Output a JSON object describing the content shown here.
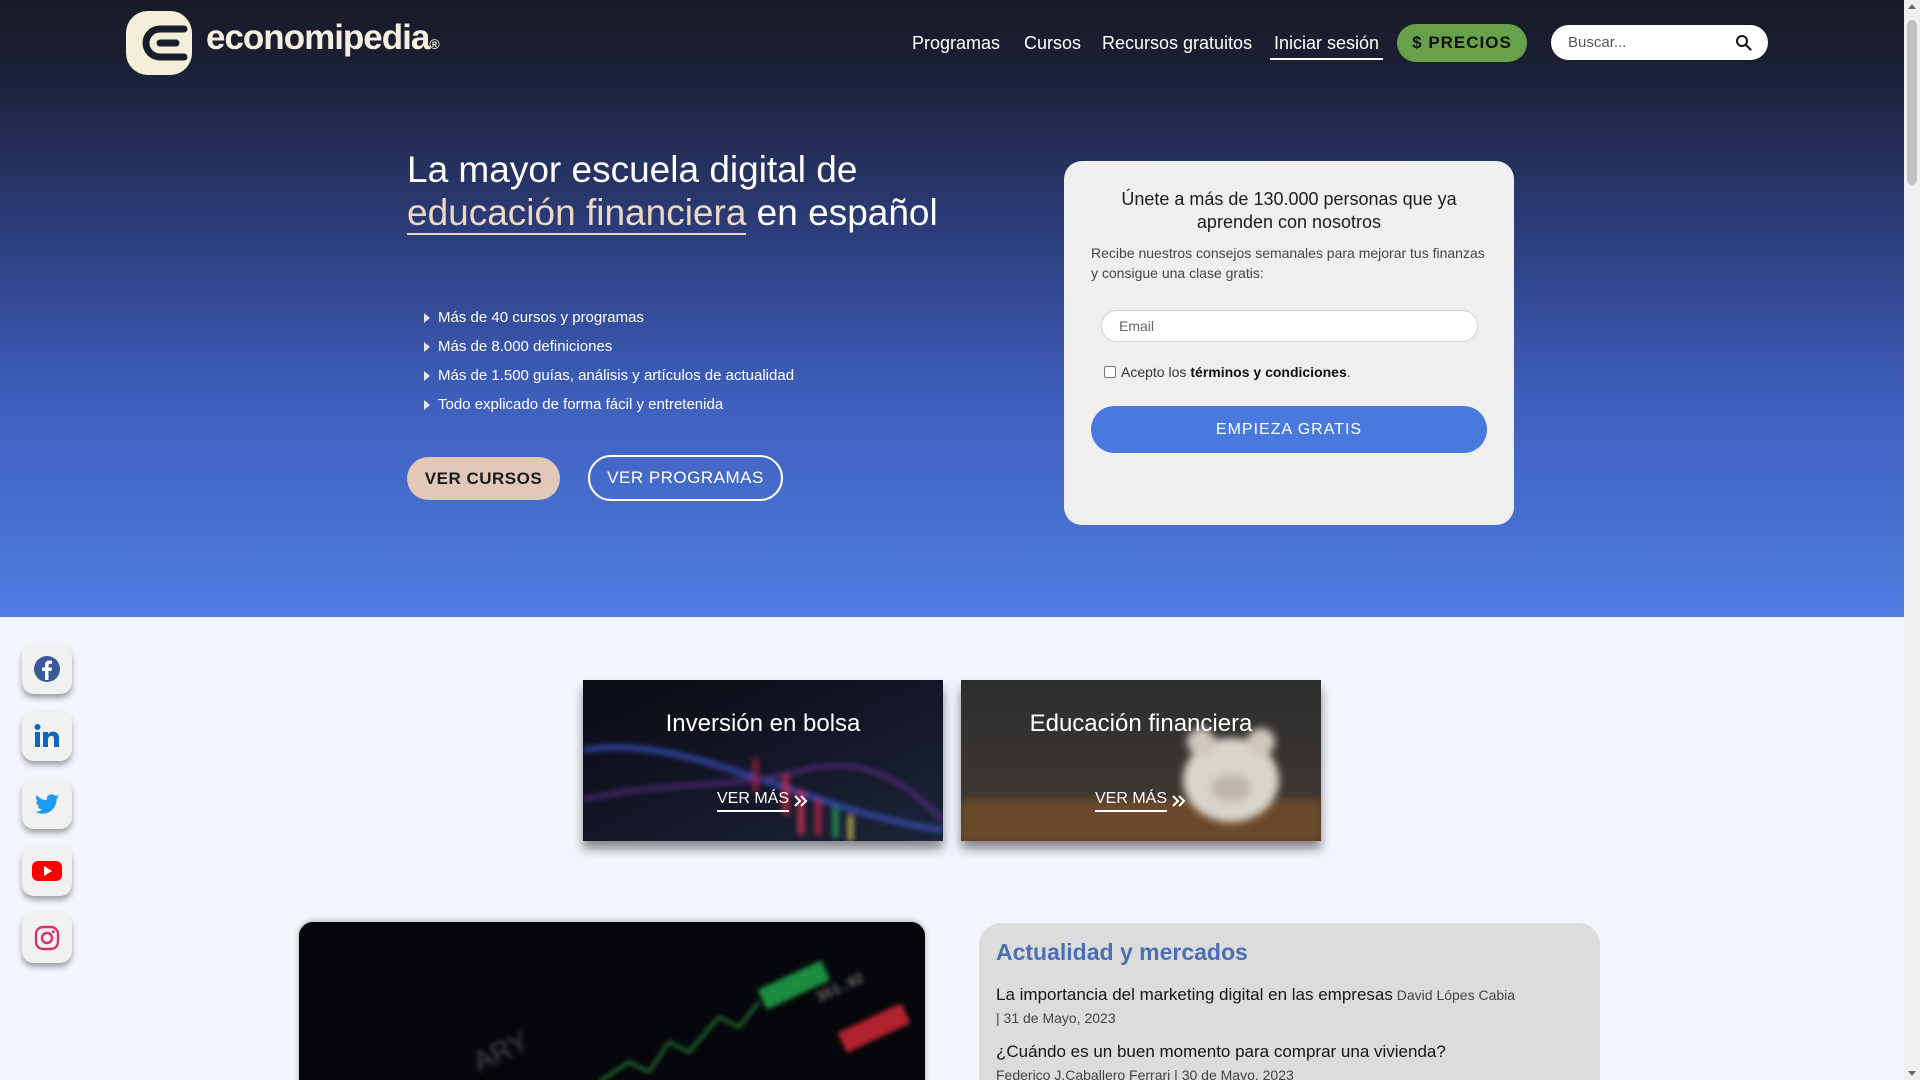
{
  "header": {
    "logo_text": "economipedia",
    "logo_mark": "®",
    "nav": [
      "Programas",
      "Cursos",
      "Recursos gratuitos",
      "Iniciar sesión"
    ],
    "precios_label": "$ PRECIOS",
    "search_placeholder": "Buscar..."
  },
  "hero": {
    "title_line1": "La mayor escuela digital de",
    "title_highlight": "educación financiera",
    "title_rest": " en español",
    "bullets": [
      "Más de 40 cursos y programas",
      "Más de 8.000 definiciones",
      "Más de 1.500 guías, análisis y artículos de actualidad",
      "Todo explicado de forma fácil y entretenida"
    ],
    "btn_cursos": "VER CURSOS",
    "btn_programas": "VER PROGRAMAS"
  },
  "signup": {
    "title": "Únete a más de 130.000 personas que ya aprenden con nosotros",
    "description": "Recibe nuestros consejos semanales para mejorar tus finanzas y consigue una clase gratis:",
    "email_placeholder": "Email",
    "checkbox_prefix": "Acepto los",
    "checkbox_link": "términos y condiciones",
    "checkbox_suffix": ".",
    "button": "EMPIEZA GRATIS"
  },
  "social": [
    "facebook-icon",
    "linkedin-icon",
    "twitter-icon",
    "youtube-icon",
    "instagram-icon"
  ],
  "categories": [
    {
      "title": "Inversión en bolsa",
      "link": "VER MÁS"
    },
    {
      "title": "Educación financiera",
      "link": "VER MÁS"
    }
  ],
  "news": {
    "heading": "Actualidad y mercados",
    "items": [
      {
        "title": "La importancia del marketing digital en las empresas",
        "meta_a": "David Lópes Cabia",
        "meta_b": "| 31 de Mayo, 2023"
      },
      {
        "title": "¿Cuándo es un buen momento para comprar una vivienda?",
        "meta_a": "Federico J.Caballero Ferrari | 30 de Mayo, 2023",
        "meta_b": ""
      }
    ]
  },
  "colors": {
    "hero_top": "#181a26",
    "hero_bottom": "#4f7de0",
    "precios_green": "#69a14a",
    "cta_blue": "#4a79de",
    "highlight_beige": "#eed8c4",
    "news_heading": "#4a6fb4"
  }
}
